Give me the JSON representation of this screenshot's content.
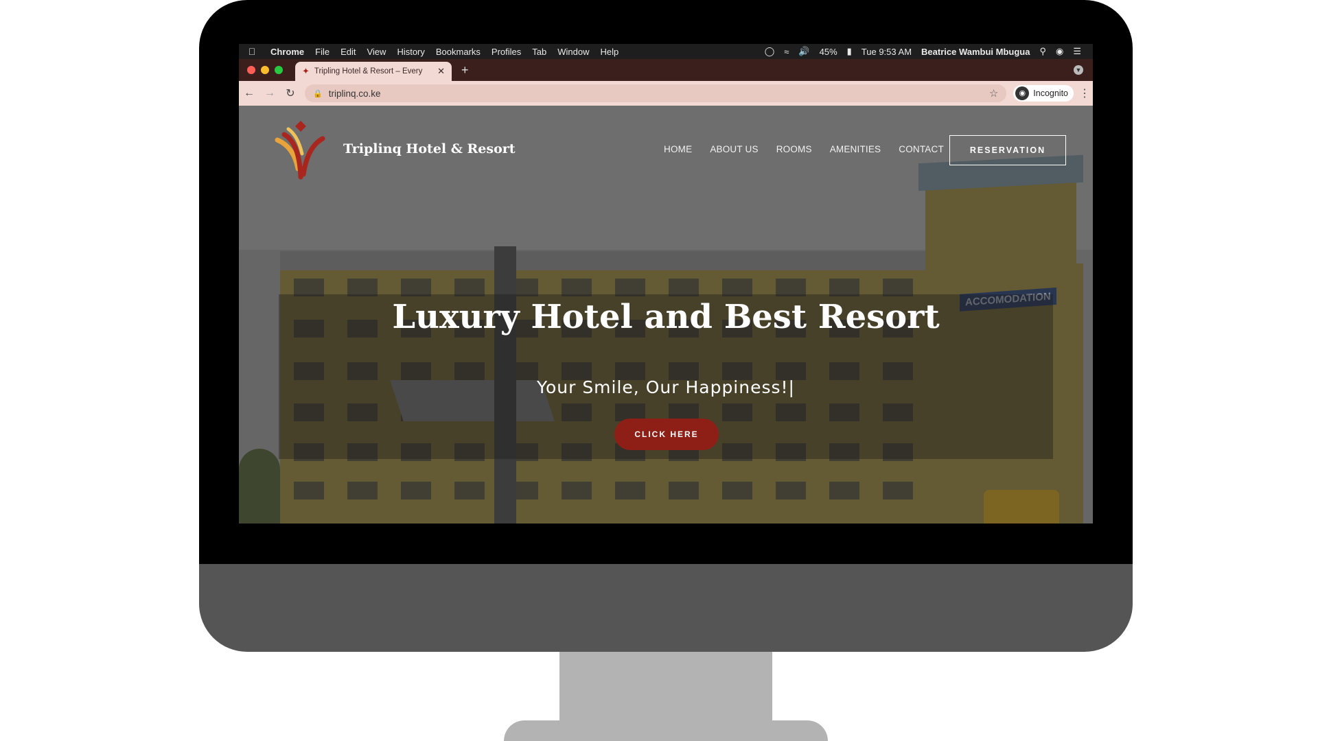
{
  "menubar": {
    "app": "Chrome",
    "items": [
      "File",
      "Edit",
      "View",
      "History",
      "Bookmarks",
      "Profiles",
      "Tab",
      "Window",
      "Help"
    ],
    "battery": "45%",
    "clock": "Tue 9:53 AM",
    "user": "Beatrice Wambui Mbugua"
  },
  "browser": {
    "tab_title": "Tripling Hotel & Resort – Every",
    "url": "triplinq.co.ke",
    "incognito_label": "Incognito"
  },
  "site": {
    "brand": "Triplinq Hotel & Resort",
    "nav": [
      "HOME",
      "ABOUT US",
      "ROOMS",
      "AMENITIES",
      "CONTACT"
    ],
    "reservation_label": "RESERVATION",
    "hero_title": "Luxury Hotel and Best Resort",
    "hero_subtitle": "Your Smile, Our Happiness!|",
    "cta_label": "CLICK HERE",
    "building_sign": "ACCOMODATION"
  },
  "colors": {
    "brand_red": "#8e1f16",
    "brand_gold": "#e8a33a",
    "tab_bg": "#f3d9d3",
    "tabstrip_bg": "#3a1f1c"
  }
}
